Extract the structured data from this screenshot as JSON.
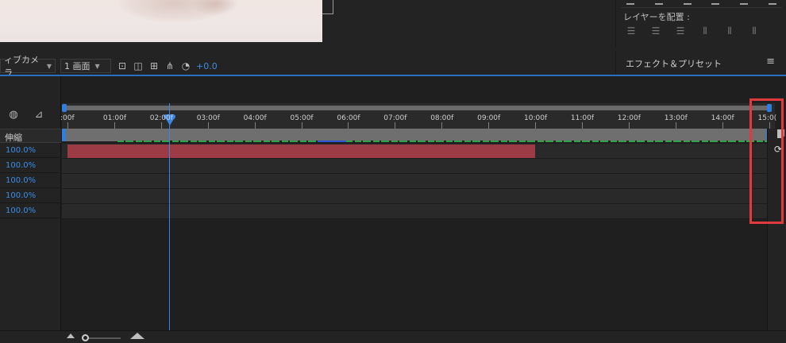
{
  "viewer_toolbar": {
    "camera_select": "ィブカメラ",
    "view_select": "1 画面",
    "exposure_value": "+0.0"
  },
  "align_panel": {
    "distribute_label": "レイヤーを配置 :"
  },
  "effects_panel": {
    "title": "エフェクト＆プリセット",
    "menu_icon": "hamburger-icon"
  },
  "timeline": {
    "stretch_header": "伸縮",
    "layers": [
      {
        "stretch": "100.0%",
        "color": "#9c3a45",
        "end_label": "10:00f"
      },
      {
        "stretch": "100.0%",
        "color": "#7f7263",
        "end_label": "15:00"
      },
      {
        "stretch": "100.0%",
        "color": "#7f7263",
        "end_label": "15:00"
      },
      {
        "stretch": "100.0%",
        "color": "#72728a",
        "end_label": "15:00"
      },
      {
        "stretch": "100.0%",
        "color": "#8a3238",
        "end_label": "15:00"
      }
    ],
    "ruler_ticks": [
      ":00f",
      "01:00f",
      "02:00f",
      "03:00f",
      "04:00f",
      "05:00f",
      "06:00f",
      "07:00f",
      "08:00f",
      "09:00f",
      "10:00f",
      "11:00f",
      "12:00f",
      "13:00f",
      "14:00f",
      "15:0("
    ],
    "current_time_tick": "02:00f"
  },
  "colors": {
    "accent_blue": "#2e7fe0",
    "highlight_red": "#e03a3f",
    "cache_green": "#2fa24a"
  }
}
